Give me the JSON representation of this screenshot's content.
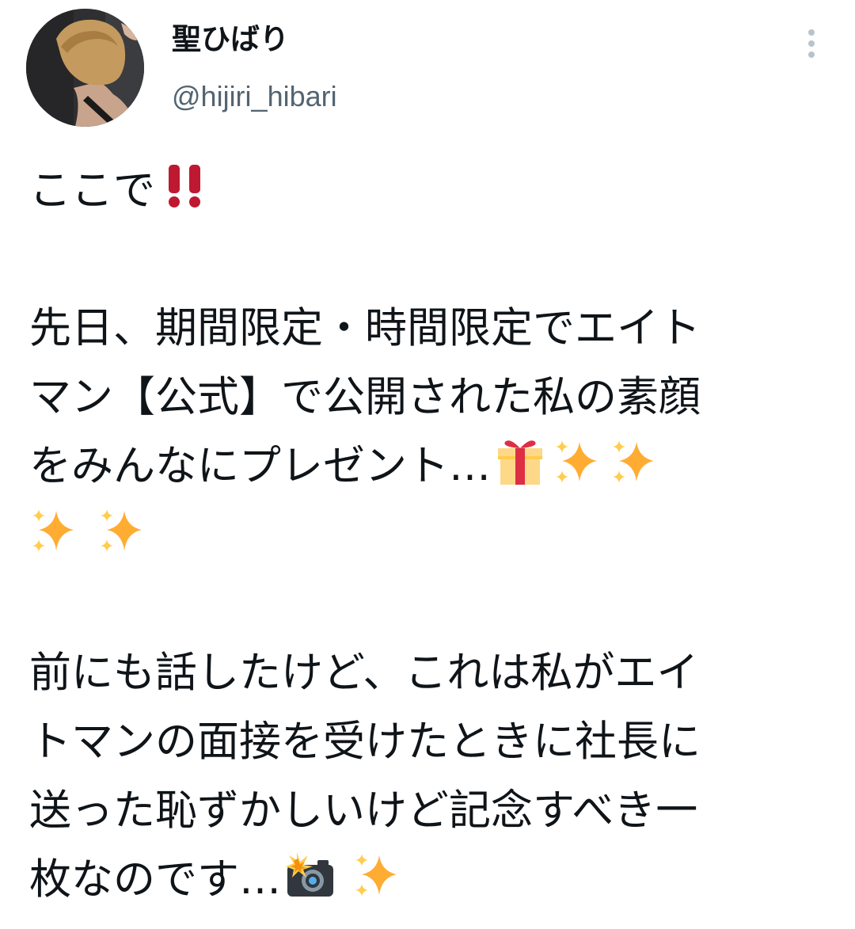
{
  "author": {
    "display_name": "聖ひばり",
    "handle": "@hijiri_hibari"
  },
  "menu": {
    "icon": "more-vertical-icon"
  },
  "tweet": {
    "p1": {
      "text": "ここで",
      "emoji": [
        "double-exclamation-icon"
      ]
    },
    "p2": {
      "line1": "先日、期間限定・時間限定でエイト",
      "line2": "マン【公式】で公開された私の素顔",
      "line3": "をみんなにプレゼント…",
      "line3_emoji": [
        "gift-icon",
        "sparkles-icon",
        "sparkles-icon"
      ],
      "line4_emoji": [
        "sparkles-icon",
        "sparkles-icon"
      ]
    },
    "p3": {
      "line1": "前にも話したけど、これは私がエイ",
      "line2": "トマンの面接を受けたときに社長に",
      "line3": "送った恥ずかしいけど記念すべき一",
      "line4": "枚なのです…",
      "line4_emoji": [
        "camera-flash-icon",
        "sparkles-icon"
      ]
    }
  },
  "colors": {
    "text": "#0f1419",
    "handle": "#536471",
    "exclamation": "#be1931",
    "sparkle": "#ffac33",
    "gift_box": "#fdd888",
    "gift_ribbon": "#dd2e44"
  }
}
